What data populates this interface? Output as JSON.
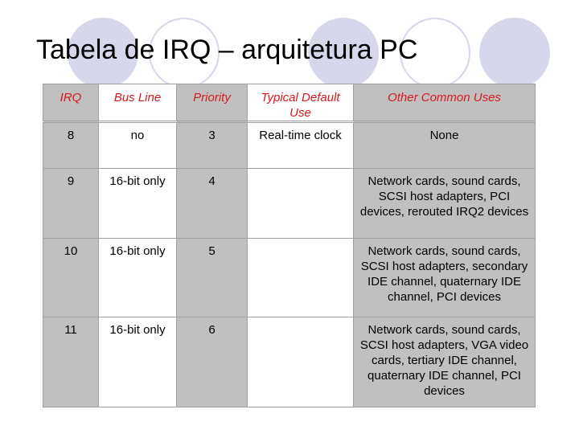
{
  "title": "Tabela de IRQ – arquitetura PC",
  "colors": {
    "header_text": "#d71920",
    "gray_cell": "#c0c0c0",
    "decoration": "#d6d7ea"
  },
  "table": {
    "headers": [
      "IRQ",
      "Bus Line",
      "Priority",
      "Typical Default Use",
      "Other Common Uses"
    ],
    "rows": [
      {
        "irq": "8",
        "bus_line": "no",
        "priority": "3",
        "typical_default_use": "Real-time clock",
        "other_common_uses": "None"
      },
      {
        "irq": "9",
        "bus_line": "16-bit only",
        "priority": "4",
        "typical_default_use": "",
        "other_common_uses": "Network cards, sound cards, SCSI host adapters, PCI devices, rerouted IRQ2 devices"
      },
      {
        "irq": "10",
        "bus_line": "16-bit only",
        "priority": "5",
        "typical_default_use": "",
        "other_common_uses": "Network cards, sound cards, SCSI host adapters, secondary IDE channel, quaternary IDE channel, PCI devices"
      },
      {
        "irq": "11",
        "bus_line": "16-bit only",
        "priority": "6",
        "typical_default_use": "",
        "other_common_uses": "Network cards, sound cards, SCSI host adapters, VGA video cards, tertiary IDE channel, quaternary IDE channel, PCI devices"
      }
    ]
  }
}
